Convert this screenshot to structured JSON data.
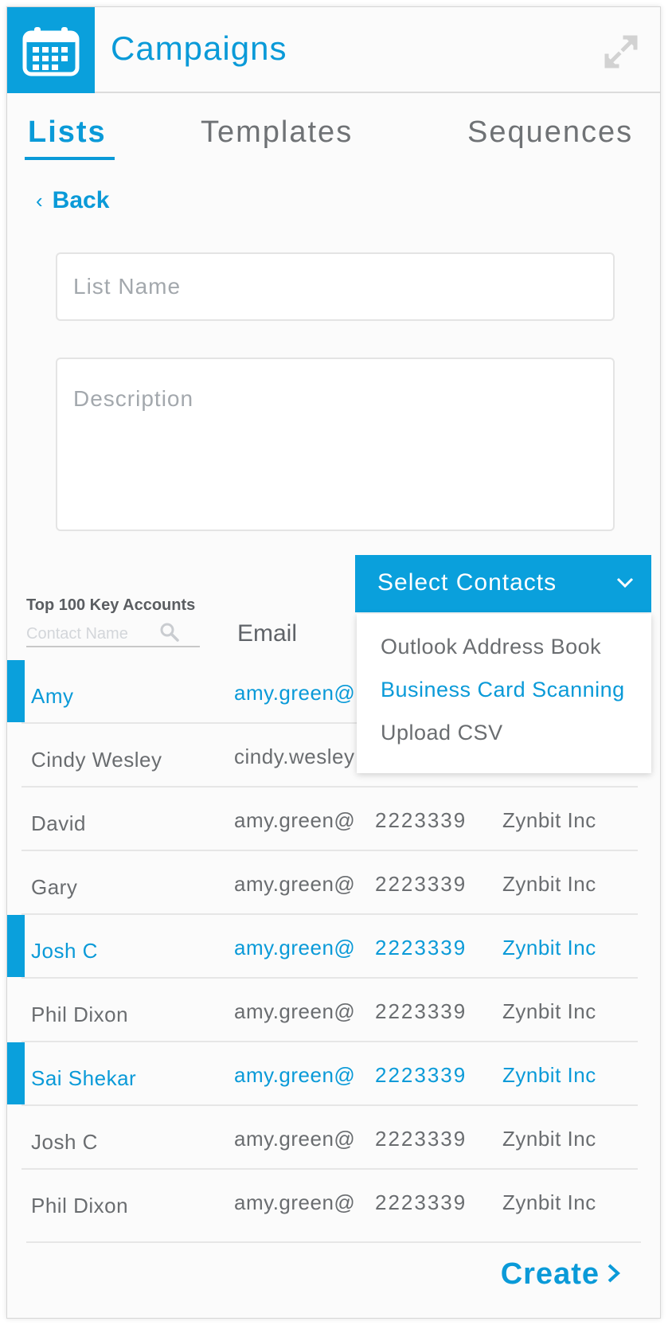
{
  "app": {
    "title": "Campaigns",
    "icon": "calendar-icon",
    "expand_icon": "expand-icon",
    "accent": "#0aa0dc"
  },
  "tabs": [
    {
      "label": "Lists",
      "active": true
    },
    {
      "label": "Templates",
      "active": false
    },
    {
      "label": "Sequences",
      "active": false
    }
  ],
  "back": {
    "label": "Back"
  },
  "form": {
    "list_name": {
      "value": "",
      "placeholder": "List Name"
    },
    "description": {
      "value": "",
      "placeholder": "Description"
    }
  },
  "contacts": {
    "group_label": "Top 100 Key Accounts",
    "search_placeholder": "Contact Name",
    "email_header": "Email",
    "rows": [
      {
        "name": "Amy",
        "email": "amy.green@",
        "phone": "",
        "company": "",
        "selected": true
      },
      {
        "name": "Cindy Wesley",
        "email": "cindy.wesley",
        "phone": "",
        "company": "",
        "selected": false
      },
      {
        "name": "David",
        "email": "amy.green@",
        "phone": "2223339",
        "company": "Zynbit Inc",
        "selected": false
      },
      {
        "name": "Gary",
        "email": "amy.green@",
        "phone": "2223339",
        "company": "Zynbit Inc",
        "selected": false
      },
      {
        "name": "Josh C",
        "email": "amy.green@",
        "phone": "2223339",
        "company": "Zynbit Inc",
        "selected": true
      },
      {
        "name": "Phil Dixon",
        "email": "amy.green@",
        "phone": "2223339",
        "company": "Zynbit Inc",
        "selected": false
      },
      {
        "name": "Sai Shekar",
        "email": "amy.green@",
        "phone": "2223339",
        "company": "Zynbit Inc",
        "selected": true
      },
      {
        "name": "Josh C",
        "email": "amy.green@",
        "phone": "2223339",
        "company": "Zynbit Inc",
        "selected": false
      },
      {
        "name": "Phil Dixon",
        "email": "amy.green@",
        "phone": "2223339",
        "company": "Zynbit Inc",
        "selected": false
      }
    ]
  },
  "select_contacts": {
    "label": "Select Contacts",
    "options": [
      {
        "label": "Outlook Address Book",
        "active": false
      },
      {
        "label": "Business Card Scanning",
        "active": true
      },
      {
        "label": "Upload CSV",
        "active": false
      }
    ]
  },
  "footer": {
    "create_label": "Create"
  }
}
